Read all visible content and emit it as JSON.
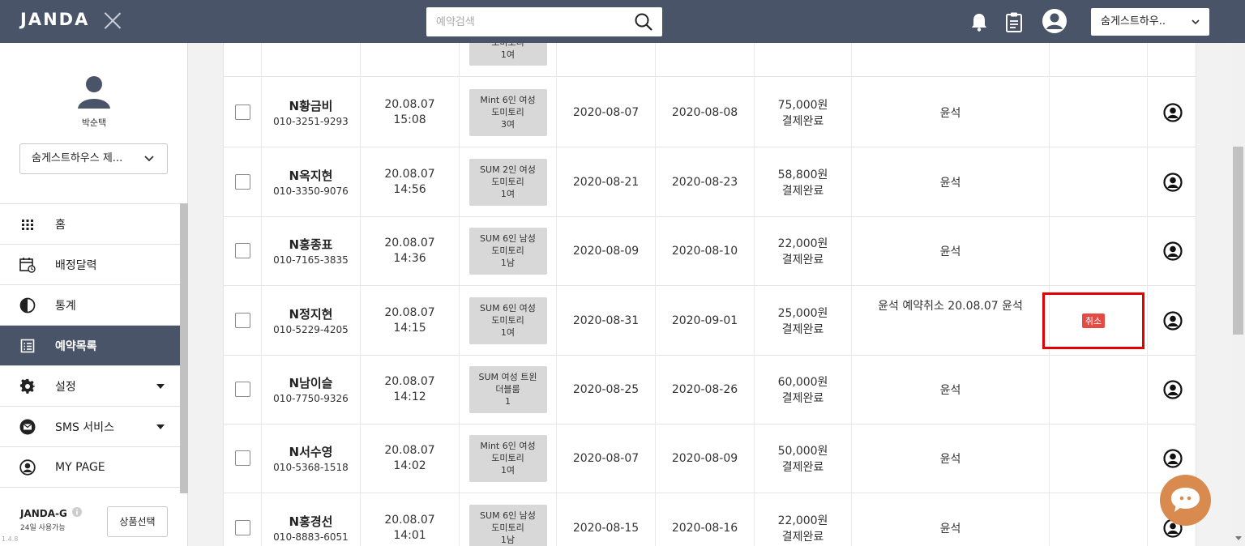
{
  "header": {
    "logo": "JANDA",
    "search_placeholder": "예약검색",
    "branch": "숨게스트하우.."
  },
  "sidebar": {
    "username": "박순택",
    "house_select": "숨게스트하우스 제...",
    "nav": [
      {
        "label": "홈",
        "icon": "grid-icon"
      },
      {
        "label": "배정달력",
        "icon": "calendar-icon"
      },
      {
        "label": "통계",
        "icon": "pie-chart-icon"
      },
      {
        "label": "예약목록",
        "icon": "list-icon",
        "active": true
      },
      {
        "label": "설정",
        "icon": "gear-icon",
        "has_submenu": true
      },
      {
        "label": "SMS 서비스",
        "icon": "mail-icon",
        "has_submenu": true
      },
      {
        "label": "MY PAGE",
        "icon": "user-icon"
      }
    ],
    "plan_name": "JANDA-G",
    "plan_days": "24일 사용가능",
    "product_button": "상품선택",
    "version": "1.4.8"
  },
  "reservations": {
    "top_partial": {
      "room": "도미토리\n1여"
    },
    "rows": [
      {
        "name": "N황금비",
        "phone": "010-3251-9293",
        "booked": "20.08.07\n15:08",
        "room": "Mint 6인 여성\n도미토리\n3여",
        "checkin": "2020-08-07",
        "checkout": "2020-08-08",
        "amount": "75,000원",
        "status": "결제완료",
        "memo": "윤석",
        "cancel": ""
      },
      {
        "name": "N옥지현",
        "phone": "010-3350-9076",
        "booked": "20.08.07\n14:56",
        "room": "SUM 2인 여성\n도미토리\n1여",
        "checkin": "2020-08-21",
        "checkout": "2020-08-23",
        "amount": "58,800원",
        "status": "결제완료",
        "memo": "윤석",
        "cancel": ""
      },
      {
        "name": "N홍종표",
        "phone": "010-7165-3835",
        "booked": "20.08.07\n14:36",
        "room": "SUM 6인 남성\n도미토리\n1남",
        "checkin": "2020-08-09",
        "checkout": "2020-08-10",
        "amount": "22,000원",
        "status": "결제완료",
        "memo": "윤석",
        "cancel": ""
      },
      {
        "name": "N정지현",
        "phone": "010-5229-4205",
        "booked": "20.08.07\n14:15",
        "room": "SUM 6인 여성\n도미토리\n1여",
        "checkin": "2020-08-31",
        "checkout": "2020-09-01",
        "amount": "25,000원",
        "status": "결제완료",
        "memo": "윤석 예약취소 20.08.07 윤석",
        "cancel": "취소"
      },
      {
        "name": "N남이슬",
        "phone": "010-7750-9326",
        "booked": "20.08.07\n14:12",
        "room": "SUM 여성 트윈\n더블룸\n1",
        "checkin": "2020-08-25",
        "checkout": "2020-08-26",
        "amount": "60,000원",
        "status": "결제완료",
        "memo": "윤석",
        "cancel": ""
      },
      {
        "name": "N서수영",
        "phone": "010-5368-1518",
        "booked": "20.08.07\n14:02",
        "room": "Mint 6인 여성\n도미토리\n1여",
        "checkin": "2020-08-07",
        "checkout": "2020-08-09",
        "amount": "50,000원",
        "status": "결제완료",
        "memo": "윤석",
        "cancel": ""
      },
      {
        "name": "N홍경선",
        "phone": "010-8883-6051",
        "booked": "20.08.07\n14:01",
        "room": "SUM 6인 남성\n도미토리\n1남",
        "checkin": "2020-08-15",
        "checkout": "2020-08-16",
        "amount": "22,000원",
        "status": "결제완료",
        "memo": "윤석",
        "cancel": ""
      }
    ]
  },
  "colors": {
    "header_bg": "#4a5469",
    "cancel_badge": "#e44b44",
    "highlight": "#e30000",
    "chat_button": "#d98b4f"
  }
}
